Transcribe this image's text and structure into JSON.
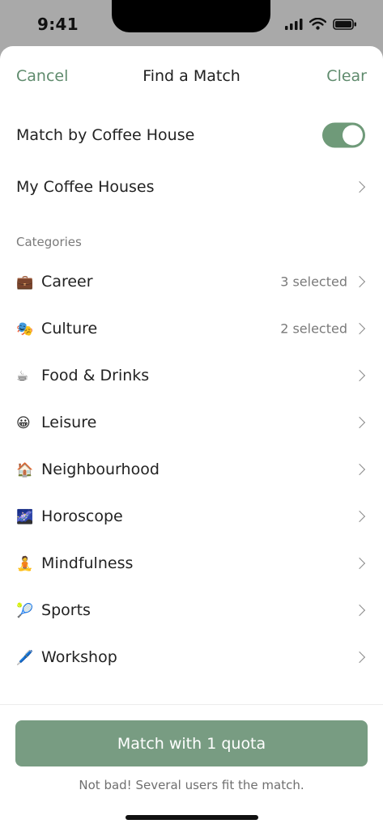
{
  "status_bar": {
    "time": "9:41",
    "signal_icon": "cellular-signal-icon",
    "wifi_icon": "wifi-icon",
    "battery_icon": "battery-icon"
  },
  "nav": {
    "cancel_label": "Cancel",
    "title": "Find a Match",
    "clear_label": "Clear"
  },
  "settings": {
    "match_by_coffee_house_label": "Match by Coffee House",
    "match_by_coffee_house_enabled": true,
    "my_coffee_houses_label": "My Coffee Houses"
  },
  "categories": {
    "title": "Categories",
    "items": [
      {
        "emoji": "💼",
        "label": "Career",
        "meta": "3 selected"
      },
      {
        "emoji": "🎭",
        "label": "Culture",
        "meta": "2 selected"
      },
      {
        "emoji": "☕",
        "label": "Food & Drinks",
        "meta": ""
      },
      {
        "emoji": "😀",
        "label": "Leisure",
        "meta": ""
      },
      {
        "emoji": "🏠",
        "label": "Neighbourhood",
        "meta": ""
      },
      {
        "emoji": "🌌",
        "label": "Horoscope",
        "meta": ""
      },
      {
        "emoji": "🧘",
        "label": "Mindfulness",
        "meta": ""
      },
      {
        "emoji": "🎾",
        "label": "Sports",
        "meta": ""
      },
      {
        "emoji": "🖊️",
        "label": "Workshop",
        "meta": ""
      }
    ]
  },
  "footer": {
    "cta_label": "Match with 1 quota",
    "helper_text": "Not bad! Several users fit the match."
  },
  "colors": {
    "accent": "#5f8b6d",
    "button": "#789c82",
    "backdrop": "#a9a9a9"
  }
}
